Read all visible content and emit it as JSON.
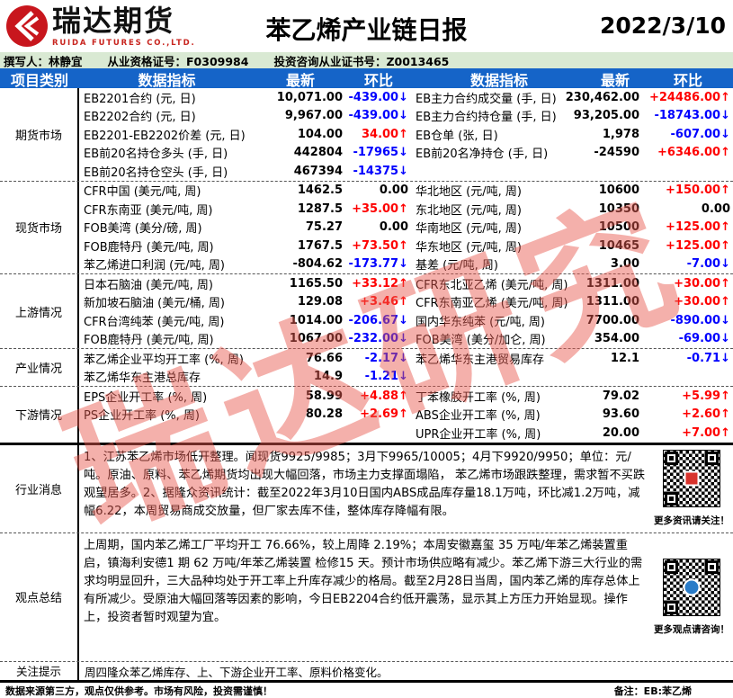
{
  "header": {
    "company_cn": "瑞达期货",
    "company_en": "RUIDA FUTURES CO.,LTD.",
    "title": "苯乙烯产业链日报",
    "date": "2022/3/10"
  },
  "byline": {
    "writer": "撰写人：林静宜",
    "qualification": "从业资格证号：F0309984",
    "advisory": "投资咨询从业证书号：Z0013465"
  },
  "colors": {
    "header_blue": "#1564c8",
    "byline_green": "#d9e9d3",
    "rise_red": "#fe0000",
    "fall_blue": "#0000fe",
    "watermark_red": "#e95a50"
  },
  "watermark_text": "瑞达研究",
  "table": {
    "headers": [
      "项目类别",
      "数据指标",
      "最新",
      "环比",
      "数据指标",
      "最新",
      "环比"
    ],
    "sections": [
      {
        "category": "期货市场",
        "rows": [
          {
            "left": {
              "name": "EB2201合约 (元, 日)",
              "value": "10,071.00",
              "change": "-439.00↓",
              "trend": "down"
            },
            "right": {
              "name": "EB主力合约成交量 (手, 日)",
              "value": "230,462.00",
              "change": "+24486.00↑",
              "trend": "up"
            }
          },
          {
            "left": {
              "name": "EB2202合约 (元, 日)",
              "value": "9,967.00",
              "change": "-439.00↓",
              "trend": "down"
            },
            "right": {
              "name": "EB主力合约持仓量 (手, 日)",
              "value": "93,205.00",
              "change": "-18743.00↓",
              "trend": "down"
            }
          },
          {
            "left": {
              "name": "EB2201-EB2202价差 (元, 日)",
              "value": "104.00",
              "change": "34.00↑",
              "trend": "up"
            },
            "right": {
              "name": "EB仓单 (张, 日)",
              "value": "1,978",
              "change": "-607.00↓",
              "trend": "down"
            }
          },
          {
            "left": {
              "name": "EB前20名持仓多头 (手, 日)",
              "value": "442804",
              "change": "-17965↓",
              "trend": "down"
            },
            "right": {
              "name": "EB前20名净持仓 (手, 日)",
              "value": "-24590",
              "change": "+6346.00↑",
              "trend": "up"
            }
          },
          {
            "left": {
              "name": "EB前20名持仓空头 (手, 日)",
              "value": "467394",
              "change": "-14375↓",
              "trend": "down"
            },
            "right": {
              "name": "",
              "value": "",
              "change": "",
              "trend": "flat"
            }
          }
        ]
      },
      {
        "category": "现货市场",
        "rows": [
          {
            "left": {
              "name": "CFR中国 (美元/吨, 周)",
              "value": "1462.5",
              "change": "0.00",
              "trend": "flat"
            },
            "right": {
              "name": "华北地区 (元/吨, 周)",
              "value": "10600",
              "change": "+150.00↑",
              "trend": "up"
            }
          },
          {
            "left": {
              "name": "CFR东南亚 (美元/吨, 周)",
              "value": "1287.5",
              "change": "+35.00↑",
              "trend": "up"
            },
            "right": {
              "name": "东北地区 (元/吨, 周)",
              "value": "10350",
              "change": "0.00",
              "trend": "flat"
            }
          },
          {
            "left": {
              "name": "FOB美湾 (美分/磅, 周)",
              "value": "75.27",
              "change": "0.00",
              "trend": "flat"
            },
            "right": {
              "name": "华南地区 (元/吨, 周)",
              "value": "10500",
              "change": "+125.00↑",
              "trend": "up"
            }
          },
          {
            "left": {
              "name": "FOB鹿特丹 (美元/吨, 周)",
              "value": "1767.5",
              "change": "+73.50↑",
              "trend": "up"
            },
            "right": {
              "name": "华东地区 (元/吨, 周)",
              "value": "10465",
              "change": "+125.00↑",
              "trend": "up"
            }
          },
          {
            "left": {
              "name": "苯乙烯进口利润 (元/吨, 周)",
              "value": "-804.62",
              "change": "-173.77↓",
              "trend": "down"
            },
            "right": {
              "name": "基差 (元/吨, 周)",
              "value": "3.00",
              "change": "-7.00↓",
              "trend": "down"
            }
          }
        ]
      },
      {
        "category": "上游情况",
        "rows": [
          {
            "left": {
              "name": "日本石脑油 (美元/吨, 周)",
              "value": "1165.50",
              "change": "+33.12↑",
              "trend": "up"
            },
            "right": {
              "name": "CFR东北亚乙烯 (美元/吨, 周)",
              "value": "1311.00",
              "change": "+30.00↑",
              "trend": "up"
            }
          },
          {
            "left": {
              "name": "新加坡石脑油 (美元/桶, 周)",
              "value": "129.08",
              "change": "+3.46↑",
              "trend": "up"
            },
            "right": {
              "name": "CFR东南亚乙烯 (美元/吨, 周)",
              "value": "1311.00",
              "change": "+30.00↑",
              "trend": "up"
            }
          },
          {
            "left": {
              "name": "CFR台湾纯苯 (美元/吨, 周)",
              "value": "1014.00",
              "change": "-206.67↓",
              "trend": "down"
            },
            "right": {
              "name": "国内华东纯苯 (元/吨, 周)",
              "value": "7700.00",
              "change": "-890.00↓",
              "trend": "down"
            }
          },
          {
            "left": {
              "name": "FOB鹿特丹 (美元/吨, 周)",
              "value": "1067.00",
              "change": "-232.00↓",
              "trend": "down"
            },
            "right": {
              "name": "FOB美湾 (美分/加仑, 周)",
              "value": "354.00",
              "change": "-69.00↓",
              "trend": "down"
            }
          }
        ]
      },
      {
        "category": "产业情况",
        "rows": [
          {
            "left": {
              "name": "苯乙烯企业平均开工率 (%, 周)",
              "value": "76.66",
              "change": "-2.17↓",
              "trend": "down"
            },
            "right": {
              "name": "苯乙烯华东主港贸易库存",
              "value": "12.1",
              "change": "-0.71↓",
              "trend": "down"
            }
          },
          {
            "left": {
              "name": "苯乙烯华东主港总库存",
              "value": "14.9",
              "change": "-1.21↓",
              "trend": "down"
            },
            "right": {
              "name": "",
              "value": "",
              "change": "",
              "trend": "flat"
            }
          }
        ]
      },
      {
        "category": "下游情况",
        "rows": [
          {
            "left": {
              "name": "EPS企业开工率 (%, 周)",
              "value": "58.99",
              "change": "+4.88↑",
              "trend": "up"
            },
            "right": {
              "name": "丁苯橡胶开工率 (%, 周)",
              "value": "79.02",
              "change": "+5.99↑",
              "trend": "up"
            }
          },
          {
            "left": {
              "name": "PS企业开工率 (%, 周)",
              "value": "80.28",
              "change": "+2.69↑",
              "trend": "up"
            },
            "right": {
              "name": "ABS企业开工率 (%, 周)",
              "value": "93.60",
              "change": "+2.60↑",
              "trend": "up"
            }
          },
          {
            "left": {
              "name": "",
              "value": "",
              "change": "",
              "trend": "flat"
            },
            "right": {
              "name": "UPR企业开工率 (%, 周)",
              "value": "20.00",
              "change": "+7.00↑",
              "trend": "up"
            }
          }
        ]
      }
    ]
  },
  "news": {
    "label": "行业消息",
    "text": "1、江苏苯乙烯市场低开整理。闻现货9925/9985；3月下9965/10005；4月下9920/9950；单位：元/吨。原油、原料、苯乙烯期货均出现大幅回落，市场主力支撑面塌陷， 苯乙烯市场跟跌整理，需求暂不买跌观望居多。2、据隆众资讯统计：截至2022年3月10日国内ABS成品库存量18.1万吨，环比减1.2万吨，减幅6.22，本周贸易商成交放量，但厂家去库不佳，整体库存降幅有限。",
    "qr_caption": "更多资讯请关注！"
  },
  "summary": {
    "label": "观点总结",
    "text": "上周期，国内苯乙烯工厂平均开工 76.66%，较上周降 2.19%；本周安徽嘉玺 35 万吨/年苯乙烯装置重启，镇海利安德1 期 62 万吨/年苯乙烯装置 检修15 天。预计市场供应略有减少。苯乙烯下游三大行业的需求均明显回升，三大品种均处于开工率上升库存减少的格局。截至2月28日当周，国内苯乙烯的库存总体上有所减少。受原油大幅回落等因素的影响，今日EB2204合约低开震荡，显示其上方压力开始显现。操作上，投资者暂时观望为宜。",
    "qr_caption": "更多观点请咨询！"
  },
  "tips": {
    "label": "关注提示",
    "text": "周四隆众苯乙烯库存、上、下游企业开工率、原料价格变化。"
  },
  "footer": {
    "disclaimer": "数据来源第三方，观点仅供参考。市场有风险，投资需谨慎！",
    "remark": "备注：EB:苯乙烯"
  }
}
